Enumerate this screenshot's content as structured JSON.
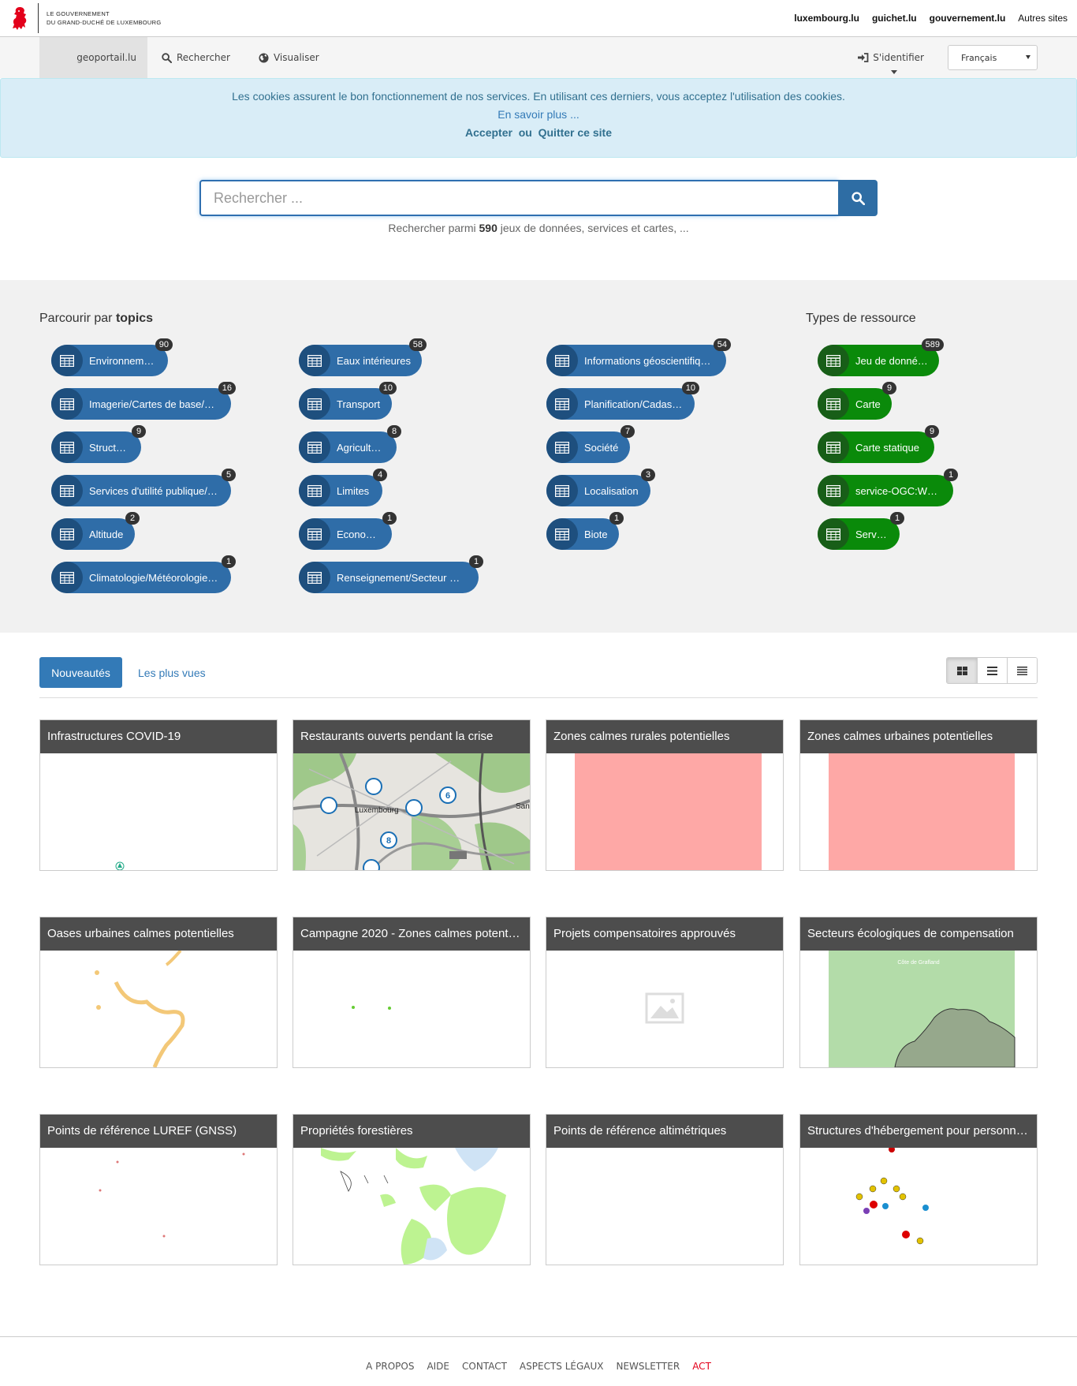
{
  "gov": {
    "line1": "Le Gouvernement",
    "line2": "du Grand-Duché de Luxembourg",
    "links": [
      "luxembourg.lu",
      "guichet.lu",
      "gouvernement.lu",
      "Autres sites"
    ]
  },
  "nav": {
    "brand": "geoportail.lu",
    "search": "Rechercher",
    "visualize": "Visualiser",
    "login": "S'identifier",
    "language": "Français"
  },
  "cookie": {
    "text": "Les cookies assurent le bon fonctionnement de nos services. En utilisant ces derniers, vous acceptez l'utilisation des cookies.",
    "more": "En savoir plus ...",
    "accept": "Accepter",
    "or": "ou",
    "quit": "Quitter ce site"
  },
  "search": {
    "placeholder": "Rechercher ...",
    "hint_before": "Rechercher parmi",
    "hint_count": "590",
    "hint_after": "jeux de données, services et cartes, ..."
  },
  "topics": {
    "title_prefix": "Parcourir par",
    "title_strong": "topics",
    "items": [
      {
        "label": "Environnement",
        "count": "90"
      },
      {
        "label": "Imagerie/Cartes de base/…",
        "count": "16"
      },
      {
        "label": "Structure",
        "count": "9"
      },
      {
        "label": "Services d'utilité publique/…",
        "count": "5"
      },
      {
        "label": "Altitude",
        "count": "2"
      },
      {
        "label": "Climatologie/Météorologie…",
        "count": "1"
      },
      {
        "label": "Eaux intérieures",
        "count": "58"
      },
      {
        "label": "Transport",
        "count": "10"
      },
      {
        "label": "Agriculture",
        "count": "8"
      },
      {
        "label": "Limites",
        "count": "4"
      },
      {
        "label": "Economie",
        "count": "1"
      },
      {
        "label": "Renseignement/Secteur …",
        "count": "1"
      },
      {
        "label": "Informations géoscientifiq…",
        "count": "54"
      },
      {
        "label": "Planification/Cadastre",
        "count": "10"
      },
      {
        "label": "Société",
        "count": "7"
      },
      {
        "label": "Localisation",
        "count": "3"
      },
      {
        "label": "Biote",
        "count": "1"
      }
    ]
  },
  "resource_types": {
    "title": "Types de ressource",
    "items": [
      {
        "label": "Jeu de données",
        "count": "589"
      },
      {
        "label": "Carte",
        "count": "9"
      },
      {
        "label": "Carte statique",
        "count": "9"
      },
      {
        "label": "service-OGC:WMS",
        "count": "1"
      },
      {
        "label": "Service",
        "count": "1"
      }
    ]
  },
  "tabs": {
    "active": "Nouveautés",
    "other": "Les plus vues"
  },
  "cards": [
    {
      "title": "Infrastructures COVID-19"
    },
    {
      "title": "Restaurants ouverts pendant la crise",
      "map_label": "Luxembourg",
      "map_label2": "San"
    },
    {
      "title": "Zones calmes rurales potentielles"
    },
    {
      "title": "Zones calmes urbaines potentielles"
    },
    {
      "title": "Oases urbaines calmes potentielles"
    },
    {
      "title": "Campagne 2020 - Zones calmes potent…"
    },
    {
      "title": "Projets compensatoires approuvés"
    },
    {
      "title": "Secteurs écologiques de compensation",
      "map_label": "Côte de Grafland"
    },
    {
      "title": "Points de référence LUREF (GNSS)"
    },
    {
      "title": "Propriétés forestières"
    },
    {
      "title": "Points de référence altimétriques"
    },
    {
      "title": "Structures d'hébergement pour personn…"
    }
  ],
  "footer": [
    "A propos",
    "Aide",
    "Contact",
    "Aspects légaux",
    "Newsletter",
    "ACT"
  ],
  "colors": {
    "primary": "#337ab7",
    "topic_chip": "#2f6da8",
    "resource_chip": "#0a8a0a",
    "act": "#e3001b"
  }
}
